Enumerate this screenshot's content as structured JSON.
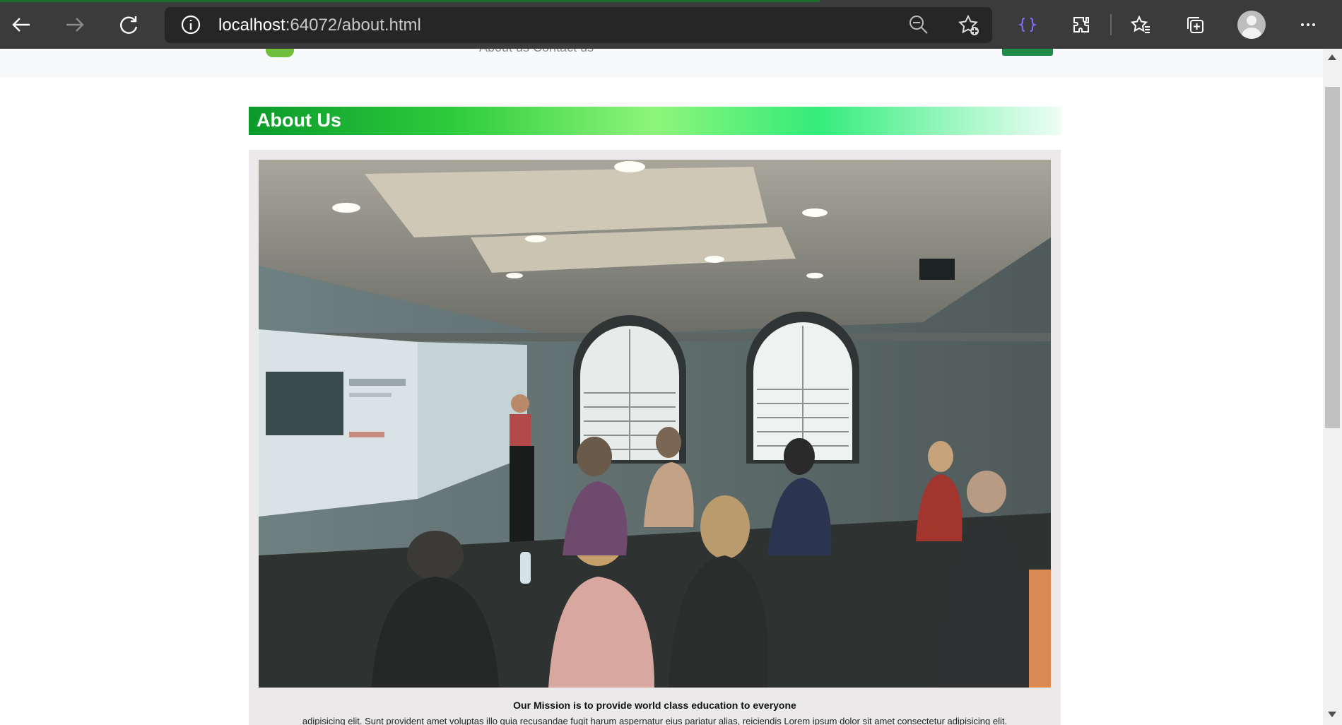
{
  "browser": {
    "url_host": "localhost",
    "url_rest": ":64072/about.html",
    "icons": [
      "back-icon",
      "forward-icon",
      "refresh-icon",
      "info-icon",
      "zoom-out-icon",
      "add-favorite-icon",
      "devtools-extension-icon",
      "extensions-icon",
      "favorites-icon",
      "collections-icon",
      "profile-avatar",
      "more-icon"
    ]
  },
  "site_nav": {
    "links_text": "About us   Contact us"
  },
  "about": {
    "heading": "About Us",
    "mission_title": "Our Mission is to provide world class education to everyone",
    "mission_text": "adipisicing elit. Sunt provident amet voluptas illo quia recusandae fugit harum aspernatur eius pariatur alias, reiciendis Lorem ipsum dolor sit amet consectetur adipisicing elit."
  },
  "colors": {
    "chrome_bg": "#3b3b3b",
    "address_bg": "#262626",
    "heading_start": "#0c9a2b",
    "heading_end": "#eefdf5",
    "card_bg": "#ebe9e9",
    "nav_button": "#1e8c46"
  }
}
